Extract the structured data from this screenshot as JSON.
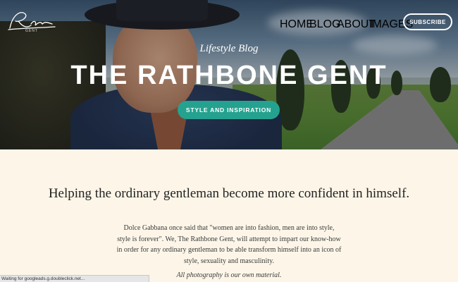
{
  "brand": {
    "logo_text": "Rathbone",
    "logo_sub": "GENT"
  },
  "nav": {
    "items": [
      {
        "label": "HOME"
      },
      {
        "label": "BLOG"
      },
      {
        "label": "ABOUT"
      },
      {
        "label": "IMAGES"
      }
    ],
    "subscribe_label": "SUBSCRIBE"
  },
  "hero": {
    "tagline": "Lifestyle Blog",
    "title": "THE RATHBONE GENT",
    "cta_label": "STYLE AND INSPIRATION"
  },
  "main": {
    "headline": "Helping the ordinary gentleman become more confident in himself.",
    "body": "Dolce Gabbana once said that \"women are into fashion, men are into style, style is forever\". We, The Rathbone Gent, will attempt to impart our know-how in order for any ordinary gentleman to be able transform himself into an icon of style, sexuality and masculinity.",
    "note": "All photography is our own material."
  },
  "status_bar": {
    "text": "Waiting for googleads.g.doubleclick.net..."
  },
  "colors": {
    "accent": "#24a28f",
    "background": "#fdf6e8"
  }
}
